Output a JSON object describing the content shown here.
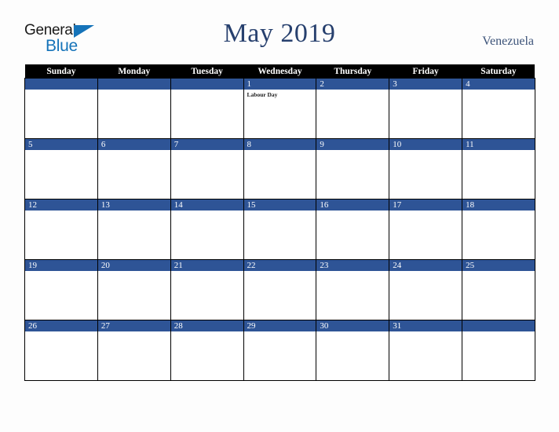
{
  "logo": {
    "word1": "General",
    "word2": "Blue",
    "triangle_color": "#1573b9",
    "text_color": "#1a1a1a"
  },
  "header": {
    "title": "May 2019",
    "country": "Venezuela",
    "title_color": "#27406e",
    "country_color": "#3c5379"
  },
  "calendar": {
    "weekday_headers": [
      "Sunday",
      "Monday",
      "Tuesday",
      "Wednesday",
      "Thursday",
      "Friday",
      "Saturday"
    ],
    "header_bg": "#000000",
    "header_text_color": "#ffffff",
    "daynum_bg": "#2e5496",
    "daynum_text_color": "#ffffff",
    "cell_bg": "#ffffff",
    "border_color": "#000000",
    "weeks": [
      [
        {
          "day": "",
          "event": ""
        },
        {
          "day": "",
          "event": ""
        },
        {
          "day": "",
          "event": ""
        },
        {
          "day": "1",
          "event": "Labour Day"
        },
        {
          "day": "2",
          "event": ""
        },
        {
          "day": "3",
          "event": ""
        },
        {
          "day": "4",
          "event": ""
        }
      ],
      [
        {
          "day": "5",
          "event": ""
        },
        {
          "day": "6",
          "event": ""
        },
        {
          "day": "7",
          "event": ""
        },
        {
          "day": "8",
          "event": ""
        },
        {
          "day": "9",
          "event": ""
        },
        {
          "day": "10",
          "event": ""
        },
        {
          "day": "11",
          "event": ""
        }
      ],
      [
        {
          "day": "12",
          "event": ""
        },
        {
          "day": "13",
          "event": ""
        },
        {
          "day": "14",
          "event": ""
        },
        {
          "day": "15",
          "event": ""
        },
        {
          "day": "16",
          "event": ""
        },
        {
          "day": "17",
          "event": ""
        },
        {
          "day": "18",
          "event": ""
        }
      ],
      [
        {
          "day": "19",
          "event": ""
        },
        {
          "day": "20",
          "event": ""
        },
        {
          "day": "21",
          "event": ""
        },
        {
          "day": "22",
          "event": ""
        },
        {
          "day": "23",
          "event": ""
        },
        {
          "day": "24",
          "event": ""
        },
        {
          "day": "25",
          "event": ""
        }
      ],
      [
        {
          "day": "26",
          "event": ""
        },
        {
          "day": "27",
          "event": ""
        },
        {
          "day": "28",
          "event": ""
        },
        {
          "day": "29",
          "event": ""
        },
        {
          "day": "30",
          "event": ""
        },
        {
          "day": "31",
          "event": ""
        },
        {
          "day": "",
          "event": ""
        }
      ]
    ]
  }
}
